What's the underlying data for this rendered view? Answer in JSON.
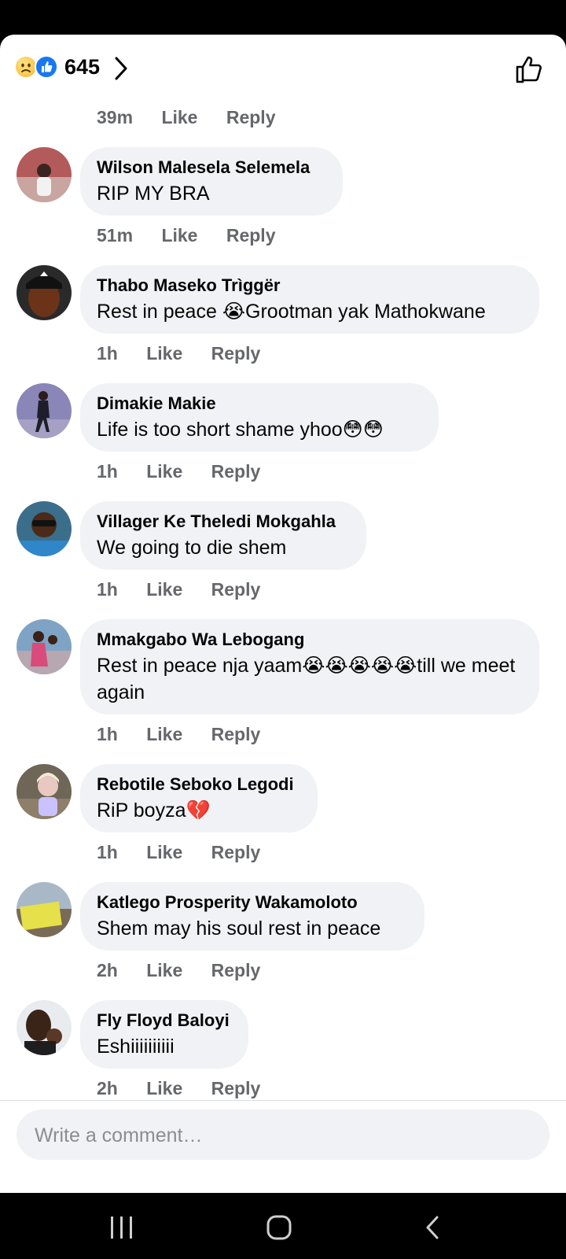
{
  "header": {
    "reactions": [
      "sad-emoji-icon",
      "like-reaction-icon"
    ],
    "reaction_count": "645"
  },
  "first_actions": {
    "time": "39m",
    "like": "Like",
    "reply": "Reply"
  },
  "comments": [
    {
      "name": "Wilson Malesela Selemela",
      "text": "RIP MY BRA",
      "time": "51m",
      "like": "Like",
      "reply": "Reply"
    },
    {
      "name": "Thabo  Maseko Trìggër",
      "text": "Rest in peace 😭Grootman yak Mathokwane",
      "time": "1h",
      "like": "Like",
      "reply": "Reply"
    },
    {
      "name": "Dimakie Makie",
      "text": "Life is too short shame yhoo😳😳",
      "time": "1h",
      "like": "Like",
      "reply": "Reply"
    },
    {
      "name": "Villager Ke Theledi Mokgahla",
      "text": "We going to die shem",
      "time": "1h",
      "like": "Like",
      "reply": "Reply"
    },
    {
      "name": "Mmakgabo Wa Lebogang",
      "text": "Rest in peace nja yaam😭😭😭😭😭till we meet again",
      "time": "1h",
      "like": "Like",
      "reply": "Reply"
    },
    {
      "name": "Rebotile Seboko Legodi",
      "text": "RiP boyza💔",
      "time": "1h",
      "like": "Like",
      "reply": "Reply"
    },
    {
      "name": "Katlego Prosperity Wakamoloto",
      "text": "Shem may his soul rest in peace",
      "time": "2h",
      "like": "Like",
      "reply": "Reply"
    },
    {
      "name": "Fly Floyd Baloyi",
      "text": "Eshiiiiiiiiii",
      "time": "2h",
      "like": "Like",
      "reply": "Reply"
    }
  ],
  "composer": {
    "placeholder": "Write a comment…"
  },
  "colors": {
    "bubble": "#f0f2f5",
    "like_blue": "#1877f2",
    "secondary_text": "#65676b"
  }
}
